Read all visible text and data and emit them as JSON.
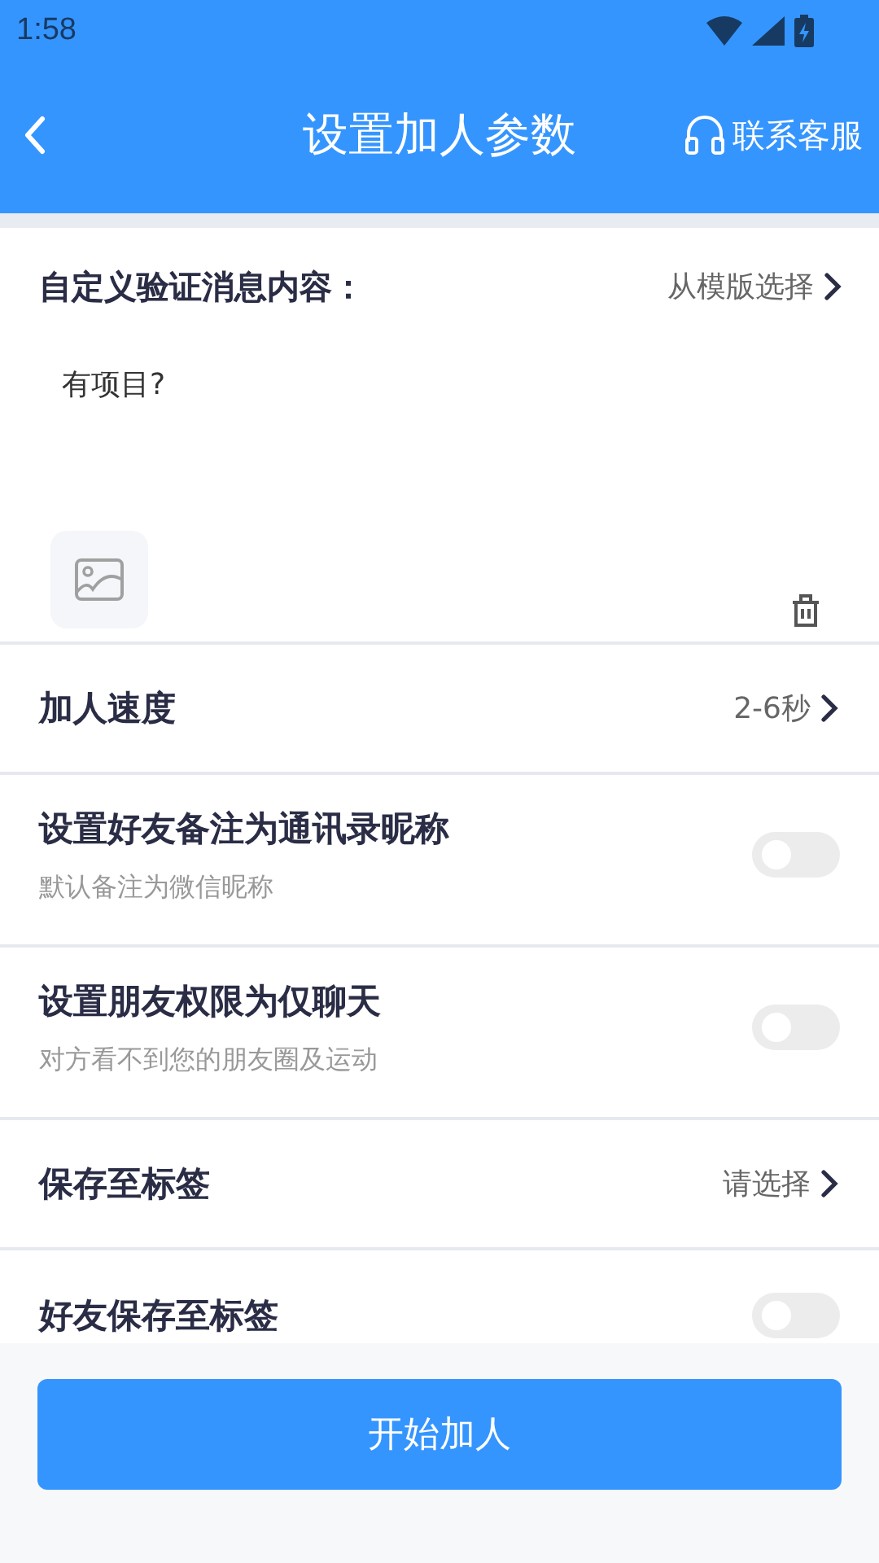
{
  "status_bar": {
    "time": "1:58"
  },
  "header": {
    "title": "设置加人参数",
    "action": "联系客服"
  },
  "message": {
    "label": "自定义验证消息内容：",
    "template_link": "从模版选择",
    "value": "有项目?"
  },
  "rows": [
    {
      "kind": "select",
      "title": "加人速度",
      "value": "2-6秒"
    },
    {
      "kind": "toggle",
      "title": "设置好友备注为通讯录昵称",
      "subtitle": "默认备注为微信昵称",
      "on": false
    },
    {
      "kind": "toggle",
      "title": "设置朋友权限为仅聊天",
      "subtitle": "对方看不到您的朋友圈及运动",
      "on": false
    },
    {
      "kind": "select",
      "title": "保存至标签",
      "value": "请选择"
    },
    {
      "kind": "toggle",
      "title": "好友保存至标签",
      "on": false
    }
  ],
  "primary_button": "开始加人"
}
